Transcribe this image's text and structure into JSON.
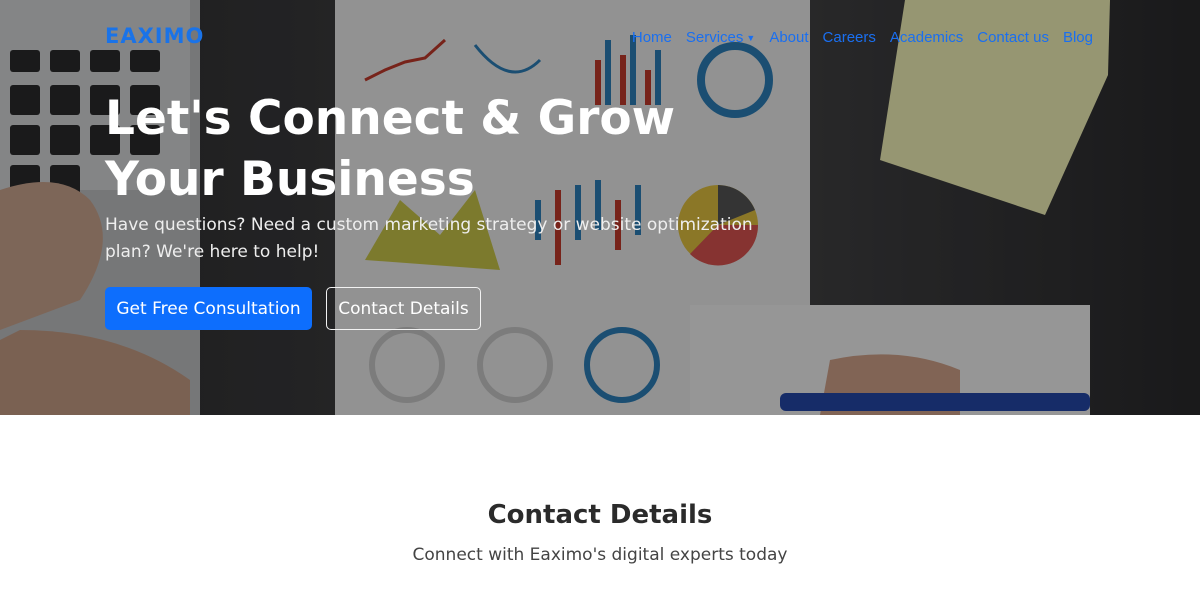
{
  "nav": {
    "brand": "EAXIMO",
    "items": [
      {
        "label": "Home"
      },
      {
        "label": "Services",
        "dropdown": true
      },
      {
        "label": "About"
      },
      {
        "label": "Careers"
      },
      {
        "label": "Academics"
      },
      {
        "label": "Contact us"
      },
      {
        "label": "Blog"
      }
    ]
  },
  "hero": {
    "title": "Let's Connect & Grow Your Business",
    "subtitle": "Have questions? Need a custom marketing strategy or website optimization plan? We're here to help!",
    "primary_button": "Get Free Consultation",
    "secondary_button": "Contact Details"
  },
  "contact_section": {
    "title": "Contact Details",
    "subtitle": "Connect with Eaximo's digital experts today"
  },
  "colors": {
    "brand": "#1a73e8",
    "nav_link": "#1a6ff0",
    "primary_button": "#0d6efd"
  }
}
